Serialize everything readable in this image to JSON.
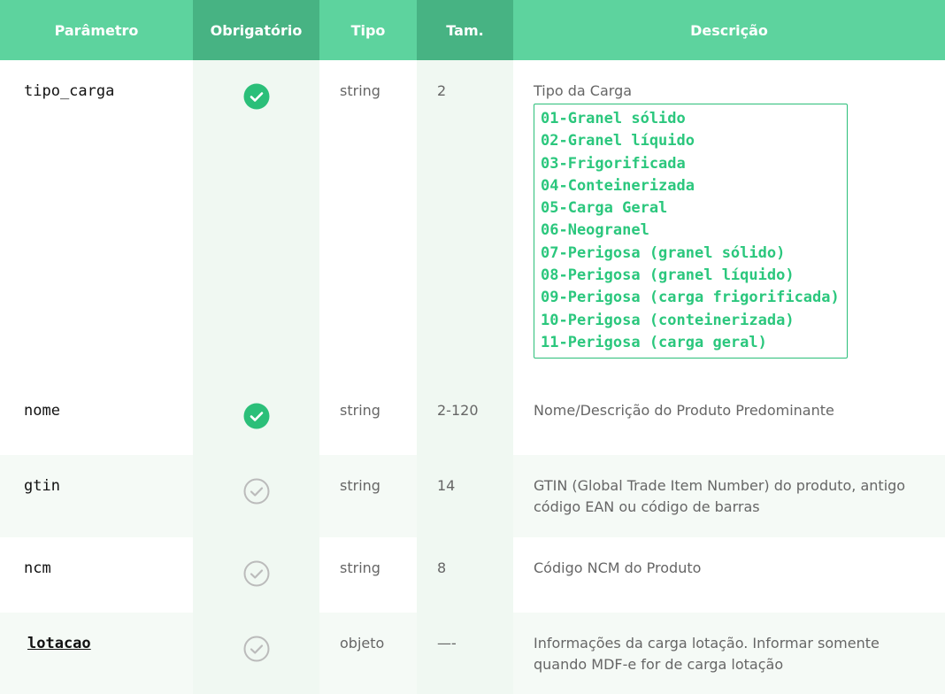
{
  "header": {
    "param": "Parâmetro",
    "required": "Obrigatório",
    "type": "Tipo",
    "size": "Tam.",
    "description": "Descrição"
  },
  "colors": {
    "header_bg": "#5dd39e",
    "header_dark": "#47b383",
    "check_filled": "#2bbf79",
    "check_outline": "#bbbbbb",
    "code_text": "#2bc77d"
  },
  "rows": [
    {
      "param": "tipo_carga",
      "required": true,
      "required_icon": "check-circle-filled-icon",
      "type": "string",
      "size": "2",
      "description": "Tipo da Carga",
      "codes": [
        "01-Granel sólido",
        "02-Granel líquido",
        "03-Frigorificada",
        "04-Conteinerizada",
        "05-Carga Geral",
        "06-Neogranel",
        "07-Perigosa (granel sólido)",
        "08-Perigosa (granel líquido)",
        "09-Perigosa (carga frigorificada)",
        "10-Perigosa (conteinerizada)",
        "11-Perigosa (carga geral)"
      ]
    },
    {
      "param": "nome",
      "required": true,
      "required_icon": "check-circle-filled-icon",
      "type": "string",
      "size": "2-120",
      "description": "Nome/Descrição do Produto Predominante"
    },
    {
      "param": "gtin",
      "required": false,
      "required_icon": "check-circle-outline-icon",
      "type": "string",
      "size": "14",
      "description": "GTIN (Global Trade Item Number) do produto, antigo código EAN ou código de barras"
    },
    {
      "param": "ncm",
      "required": false,
      "required_icon": "check-circle-outline-icon",
      "type": "string",
      "size": "8",
      "description": "Código NCM do Produto"
    },
    {
      "param": "lotacao",
      "required": false,
      "required_icon": "check-circle-outline-icon",
      "type": "objeto",
      "size": "—-",
      "description": "Informações da carga lotação. Informar somente quando MDF-e for de carga lotação"
    }
  ]
}
